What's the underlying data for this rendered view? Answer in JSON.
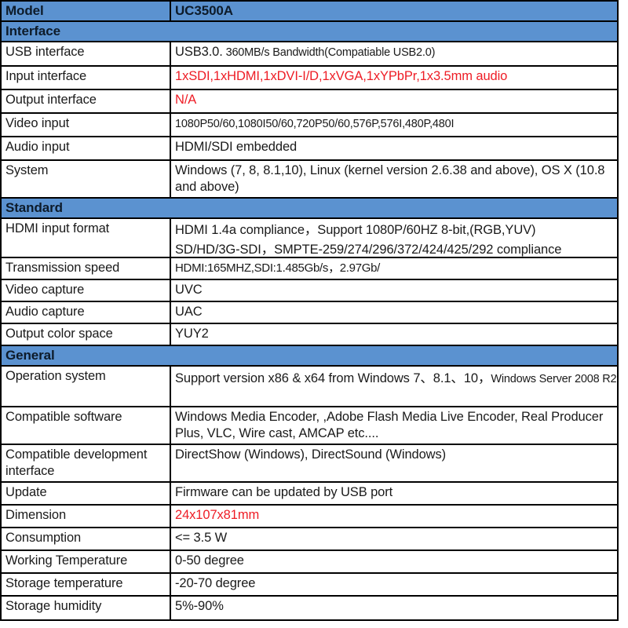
{
  "table": {
    "model_header": {
      "label": "Model",
      "value": "UC3500A"
    },
    "sections": [
      {
        "title": "Interface",
        "rows": [
          {
            "label": "USB interface",
            "value_main": "USB3.0.",
            "value_small": " 360MB/s Bandwidth(Compatiable USB2.0)",
            "color": "#1a1a1a"
          },
          {
            "label": "Input interface",
            "value_main": "1xSDI,1xHDMI,1xDVI-I/D,1xVGA,1xYPbPr,1x3.5mm audio",
            "value_small": "",
            "color": "#ee1c25"
          },
          {
            "label": "Output interface",
            "value_main": "N/A",
            "value_small": "",
            "color": "#ee1c25"
          },
          {
            "label": "Video input",
            "value_main": "",
            "value_small": "1080P50/60,1080I50/60,720P50/60,576P,576I,480P,480I",
            "color": "#1a1a1a"
          },
          {
            "label": "Audio input",
            "value_main": "HDMI/SDI embedded",
            "value_small": "",
            "color": "#1a1a1a"
          },
          {
            "label": "System",
            "value_main": "Windows (7, 8, 8.1,10), Linux (kernel version 2.6.38 and above), OS X (10.8 and above)",
            "value_small": "",
            "color": "#1a1a1a"
          }
        ]
      },
      {
        "title": "Standard",
        "rows": [
          {
            "label": "HDMI input format",
            "value_line1": "HDMI 1.4a compliance，Support 1080P/60HZ 8-bit,(RGB,YUV)",
            "value_line2": "SD/HD/3G-SDI，SMPTE-259/274/296/372/424/425/292 compliance",
            "color": "#1a1a1a"
          },
          {
            "label": "Transmission speed",
            "value_main": "",
            "value_small": "HDMI:165MHZ,SDI:1.485Gb/s，2.97Gb/",
            "color": "#1a1a1a"
          },
          {
            "label": "Video capture",
            "value_main": "UVC",
            "value_small": "",
            "color": "#1a1a1a"
          },
          {
            "label": "Audio capture",
            "value_main": "UAC",
            "value_small": "",
            "color": "#1a1a1a"
          },
          {
            "label": "Output color space",
            "value_main": "YUY2",
            "value_small": "",
            "color": "#1a1a1a"
          }
        ]
      },
      {
        "title": "General",
        "rows": [
          {
            "label": "Operation system",
            "value_main": "Support  version x86 & x64 from Windows 7、8.1、10，",
            "value_small": "Windows Server 2008 R2",
            "color": "#1a1a1a"
          },
          {
            "label": "Compatible software",
            "value_main": "Windows Media Encoder, ,Adobe Flash Media Live Encoder, Real Producer Plus, VLC, Wire cast, AMCAP etc....",
            "value_small": "",
            "color": "#1a1a1a"
          },
          {
            "label": "Compatible development interface",
            "value_main": "DirectShow (Windows), DirectSound (Windows)",
            "value_small": "",
            "color": "#1a1a1a"
          },
          {
            "label": "Update",
            "value_main": "Firmware can be updated by USB port",
            "value_small": "",
            "color": "#1a1a1a"
          },
          {
            "label": "Dimension",
            "value_main": "24x107x81mm",
            "value_small": "",
            "color": "#ee1c25"
          },
          {
            "label": "Consumption",
            "value_main": "<= 3.5 W",
            "value_small": "",
            "color": "#1a1a1a"
          },
          {
            "label": "Working Temperature",
            "value_main": "0-50 degree",
            "value_small": "",
            "color": "#1a1a1a"
          },
          {
            "label": "Storage temperature",
            "value_main": "-20-70 degree",
            "value_small": "",
            "color": "#1a1a1a"
          },
          {
            "label": "Storage humidity",
            "value_main": "5%-90%",
            "value_small": "",
            "color": "#1a1a1a"
          }
        ]
      }
    ],
    "colors": {
      "header_blue": "#5b92d0",
      "accent_red": "#ee1c25",
      "border": "#000000",
      "text": "#1a1a1a"
    }
  }
}
